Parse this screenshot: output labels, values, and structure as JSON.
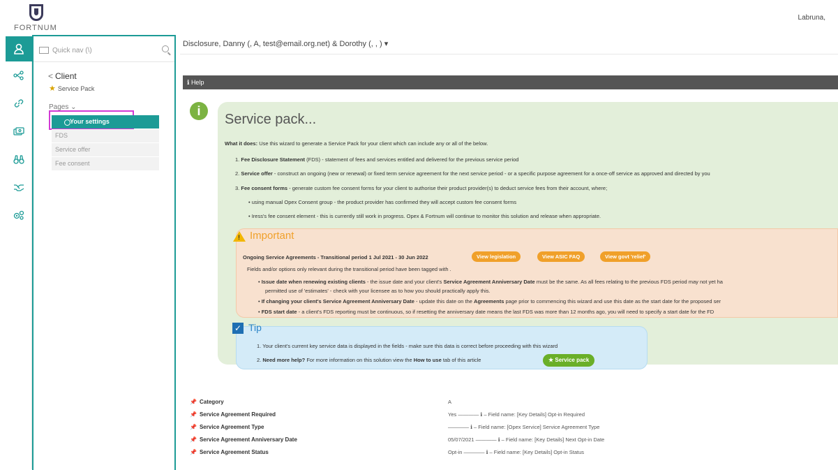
{
  "brand": {
    "logo_text": "FORTNUM"
  },
  "header": {
    "user": "Labruna,"
  },
  "sidebar": {
    "quicknav_placeholder": "Quick nav (\\)",
    "back_label": "Client",
    "subtitle": "Service Pack",
    "pages_label": "Pages",
    "pages_chevron": "⌄",
    "items": [
      {
        "label": "Your settings"
      },
      {
        "label": "FDS"
      },
      {
        "label": "Service offer"
      },
      {
        "label": "Fee consent"
      }
    ]
  },
  "main": {
    "title": "Disclosure, Danny (, A, test@email.org.net) & Dorothy (, , )",
    "help_label": "Help",
    "service_pack": {
      "title": "Service pack...",
      "what_label": "What it does:",
      "what_text": "Use this wizard to generate a Service Pack for your client which can include any or all of the below.",
      "items": [
        {
          "num": "1.",
          "bold": "Fee Disclosure Statement",
          "text": "(FDS) - statement of fees and services entitled and delivered for the previous service period"
        },
        {
          "num": "2.",
          "bold": "Service offer",
          "text": "- construct an ongoing (new or renewal) or fixed term service agreement for the next service period - or a specific purpose agreement for a once-off service as approved and directed by you"
        },
        {
          "num": "3.",
          "bold": "Fee consent forms",
          "text": "- generate custom fee consent forms for your client to authorise their product provider(s) to deduct service fees from their account, where;"
        }
      ],
      "bullets": [
        "using manual Opex Consent group - the product provider has confirmed they will accept custom fee consent forms",
        "Iress's fee consent element - this is currently still work in progress. Opex & Fortnum will continue to monitor this solution and release when appropriate."
      ]
    },
    "important": {
      "title": "Important",
      "heading": "Ongoing Service Agreements - Transitional period 1 Jul 2021 - 30 Jun 2022",
      "buttons": [
        "View legislation",
        "View ASIC FAQ",
        "View govt 'relief'"
      ],
      "intro": "Fields and/or options only relevant during the transitional period have been tagged with .",
      "b1_bold": "Issue date when renewing existing clients",
      "b1_text": "- the issue date and your client's",
      "b1_bold2": "Service Agreement Anniversary Date",
      "b1_text2": "must be the same. As all fees relating to the previous FDS period may not yet ha",
      "b1_cont": "permitted use of 'estimates' - check with your licensee as to how you should practically apply this.",
      "b2_bold": "If changing your client's Service Agreement Anniversary Date",
      "b2_text": "- update this date on the",
      "b2_bold2": "Agreements",
      "b2_text2": "page prior to commencing this wizard and use this date as the start date for the proposed ser",
      "b3_bold": "FDS start date",
      "b3_text": "- a client's FDS reporting must be continuous, so if resetting the anniversary date means the last FDS was more than 12 months ago, you will need to specify a start date for the FD"
    },
    "tip": {
      "title": "Tip",
      "line1": "1. Your client's current key service data is displayed in the  fields - make sure this data is correct before proceeding with this wizard",
      "line2_num": "2.",
      "line2_bold": "Need more help?",
      "line2_text": "For more information on this solution view the",
      "line2_bold2": "How to use",
      "line2_text2": "tab of this article",
      "button": "Service pack"
    },
    "fields": [
      {
        "label": "Category",
        "value": "A"
      },
      {
        "label": "Service Agreement Required",
        "value": "Yes ———— ℹ – Field name: [Key Details] Opt-in Required"
      },
      {
        "label": "Service Agreement Type",
        "value": "———— ℹ – Field name: [Opex Service] Service Agreement Type"
      },
      {
        "label": "Service Agreement Anniversary Date",
        "value": "05/07/2021 ———— ℹ – Field name: [Key Details] Next Opt-in Date"
      },
      {
        "label": "Service Agreement Status",
        "value": "Opt-in ———— ℹ – Field name: [Key Details] Opt-in Status"
      }
    ]
  }
}
